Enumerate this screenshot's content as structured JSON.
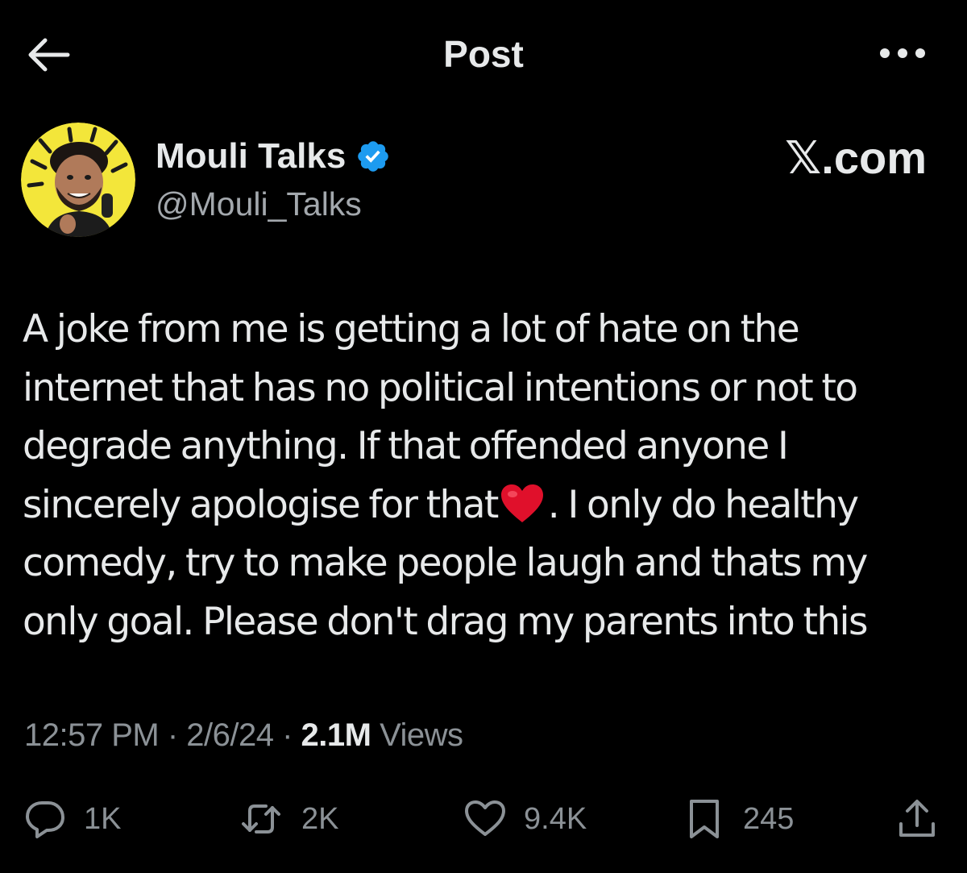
{
  "header": {
    "title": "Post",
    "back_icon": "arrow-left-icon",
    "more_icon": "more-horizontal-icon"
  },
  "author": {
    "name": "Mouli Talks",
    "handle": "@Mouli_Talks",
    "verified": true,
    "avatar_bg": "#f3e63a"
  },
  "watermark": "𝕏.com",
  "post": {
    "lines": [
      "A joke from me is getting a lot of hate on the",
      "internet that has no political intentions or not to",
      "degrade anything. If that offended anyone I",
      "sincerely apologise for that",
      ". I only do healthy",
      "comedy, try to make people laugh and thats my",
      "only goal. Please don't drag my parents into this"
    ],
    "emoji": "heart-icon"
  },
  "meta": {
    "time": "12:57 PM",
    "sep1": " · ",
    "date": "2/6/24",
    "sep2": " · ",
    "views_count": "2.1M",
    "views_label": " Views"
  },
  "actions": {
    "replies": "1K",
    "reposts": "2K",
    "likes": "9.4K",
    "bookmarks": "245"
  },
  "colors": {
    "background": "#000000",
    "text": "#e7e9ea",
    "secondary": "#8b9196",
    "verified": "#1d9bf0",
    "heart": "#e0102b"
  }
}
